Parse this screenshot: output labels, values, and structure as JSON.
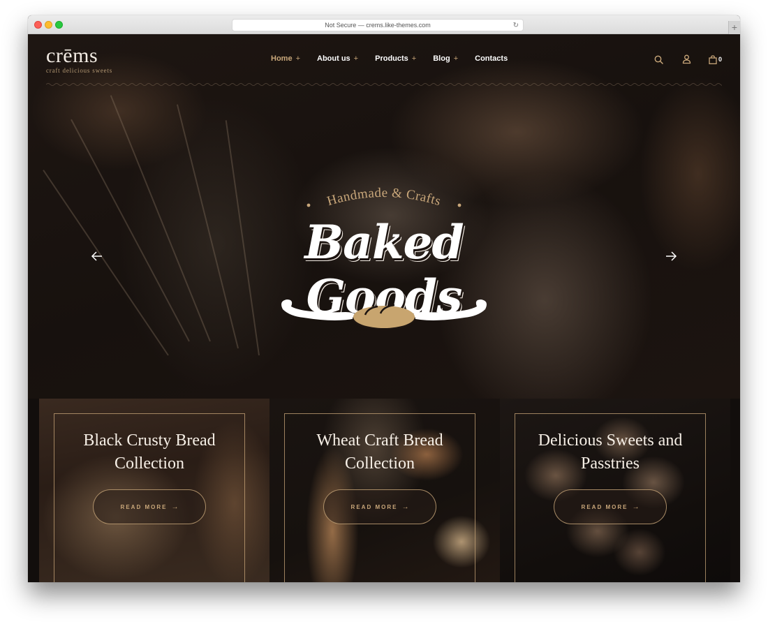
{
  "browser": {
    "address": "Not Secure — crems.like-themes.com",
    "reload_icon": "reload-icon",
    "new_tab_label": "+"
  },
  "site": {
    "logo_name": "crēms",
    "logo_tagline": "craft delicious sweets"
  },
  "nav": {
    "items": [
      {
        "label": "Home",
        "has_submenu": true,
        "active": true
      },
      {
        "label": "About us",
        "has_submenu": true,
        "active": false
      },
      {
        "label": "Products",
        "has_submenu": true,
        "active": false
      },
      {
        "label": "Blog",
        "has_submenu": true,
        "active": false
      },
      {
        "label": "Contacts",
        "has_submenu": false,
        "active": false
      }
    ],
    "plus": "+"
  },
  "header_icons": {
    "search": "search-icon",
    "account": "user-icon",
    "cart": "shopping-bag-icon",
    "cart_count": "0"
  },
  "hero": {
    "kicker": "Handmade & Crafts",
    "title": "Baked Goods",
    "prev_icon": "arrow-left-icon",
    "next_icon": "arrow-right-icon"
  },
  "cards": [
    {
      "title_line1": "Black Crusty Bread",
      "title_line2": "Collection",
      "button": "READ MORE",
      "arrow": "→"
    },
    {
      "title_line1": "Wheat Craft Bread",
      "title_line2": "Collection",
      "button": "READ MORE",
      "arrow": "→"
    },
    {
      "title_line1": "Delicious Sweets and",
      "title_line2": "Passtries",
      "button": "READ MORE",
      "arrow": "→"
    }
  ],
  "colors": {
    "accent": "#c9a77a",
    "background": "#120e0c",
    "text": "#ffffff",
    "bread_icon": "#c8a56f"
  }
}
